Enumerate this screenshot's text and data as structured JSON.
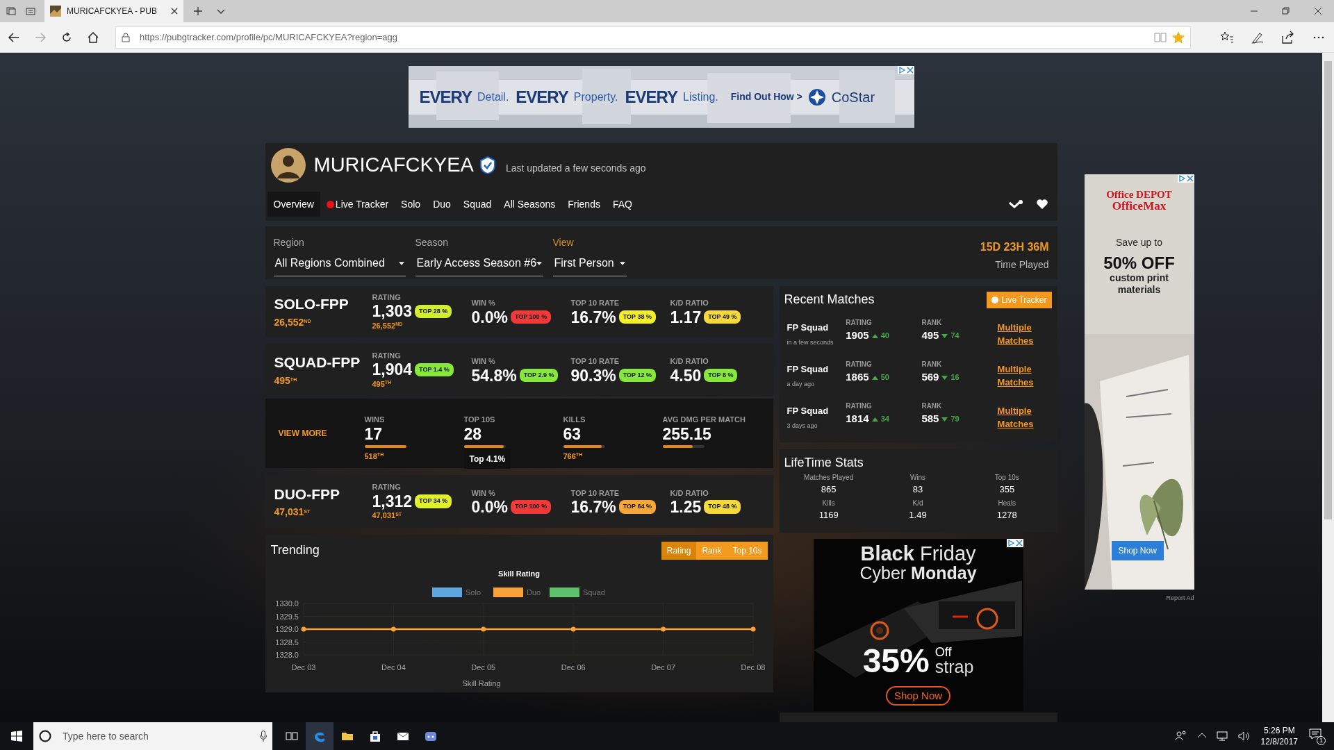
{
  "browser": {
    "tab_title": "MURICAFCKYEA - PUB",
    "url": "https://pubgtracker.com/profile/pc/MURICAFCKYEA?region=agg",
    "favorite": true
  },
  "top_ad": {
    "words": [
      {
        "text": "EVERY",
        "kind": "strong"
      },
      {
        "text": "Detail.",
        "kind": "light"
      },
      {
        "text": "EVERY",
        "kind": "strong"
      },
      {
        "text": "Property.",
        "kind": "light"
      },
      {
        "text": "EVERY",
        "kind": "strong"
      },
      {
        "text": "Listing.",
        "kind": "light"
      },
      {
        "text": "Find Out How >",
        "kind": "cta"
      },
      {
        "text": "CoStar",
        "kind": "logo"
      }
    ]
  },
  "profile": {
    "name": "MURICAFCKYEA",
    "verified": true,
    "updated": "Last updated a few seconds ago"
  },
  "nav": [
    {
      "label": "Overview",
      "selected": true,
      "live": false
    },
    {
      "label": "Live Tracker",
      "selected": false,
      "live": true
    },
    {
      "label": "Solo",
      "selected": false,
      "live": false
    },
    {
      "label": "Duo",
      "selected": false,
      "live": false
    },
    {
      "label": "Squad",
      "selected": false,
      "live": false
    },
    {
      "label": "All Seasons",
      "selected": false,
      "live": false
    },
    {
      "label": "Friends",
      "selected": false,
      "live": false
    },
    {
      "label": "FAQ",
      "selected": false,
      "live": false
    }
  ],
  "filters": [
    {
      "label": "Region",
      "value": "All Regions Combined",
      "accent": false
    },
    {
      "label": "Season",
      "value": "Early Access Season #6",
      "accent": false
    },
    {
      "label": "View",
      "value": "First Person",
      "accent": true
    }
  ],
  "time_played": {
    "value": "15D 23H 36M",
    "label": "Time Played"
  },
  "modes": [
    {
      "name": "SOLO-FPP",
      "rank": "26,552$^{ND}$",
      "stats": [
        {
          "label": "RATING",
          "value": "1,303",
          "badge": "TOP 28 %",
          "color": "#d2ee2c",
          "sub": "26,552$^{ND}$"
        },
        {
          "label": "WIN %",
          "value": "0.0%",
          "badge": "TOP 100 %",
          "color": "#f03a3a"
        },
        {
          "label": "TOP 10 RATE",
          "value": "16.7%",
          "badge": "TOP 38 %",
          "color": "#f2ee2c"
        },
        {
          "label": "K/D RATIO",
          "value": "1.17",
          "badge": "TOP 49 %",
          "color": "#f5d93c"
        }
      ]
    },
    {
      "name": "SQUAD-FPP",
      "rank": "495$^{TH}$",
      "stats": [
        {
          "label": "RATING",
          "value": "1,904",
          "badge": "TOP 1.4 %",
          "color": "#86e83a",
          "sub": "495$^{TH}$"
        },
        {
          "label": "WIN %",
          "value": "54.8%",
          "badge": "TOP 2.9 %",
          "color": "#86e83a"
        },
        {
          "label": "TOP 10 RATE",
          "value": "90.3%",
          "badge": "TOP 12 %",
          "color": "#86e83a"
        },
        {
          "label": "K/D RATIO",
          "value": "4.50",
          "badge": "TOP 8 %",
          "color": "#86e83a"
        }
      ],
      "details": {
        "link": "VIEW MORE",
        "stats": [
          {
            "label": "WINS",
            "value": "17",
            "level": 1.0,
            "rank": "518$^{TH}$"
          },
          {
            "label": "TOP 10S",
            "value": "28",
            "level": 0.95,
            "tooltip": "Top 4.1%"
          },
          {
            "label": "KILLS",
            "value": "63",
            "level": 0.92,
            "rank": "766$^{TH}$"
          },
          {
            "label": "AVG DMG PER MATCH",
            "value": "255.15",
            "level": 0.73
          }
        ]
      }
    },
    {
      "name": "DUO-FPP",
      "rank": "47,031$^{ST}$",
      "stats": [
        {
          "label": "RATING",
          "value": "1,312",
          "badge": "TOP 34 %",
          "color": "#e0f02c",
          "sub": "47,031$^{ST}$"
        },
        {
          "label": "WIN %",
          "value": "0.0%",
          "badge": "TOP 100 %",
          "color": "#f03a3a"
        },
        {
          "label": "TOP 10 RATE",
          "value": "16.7%",
          "badge": "TOP 64 %",
          "color": "#f7a73a"
        },
        {
          "label": "K/D RATIO",
          "value": "1.25",
          "badge": "TOP 48 %",
          "color": "#f5d93c"
        }
      ]
    }
  ],
  "trending": {
    "title": "Trending",
    "buttons": [
      {
        "label": "Rating",
        "selected": true
      },
      {
        "label": "Rank",
        "selected": false
      },
      {
        "label": "Top 10s",
        "selected": false
      }
    ],
    "chart_data": {
      "type": "line",
      "title": "Skill Rating",
      "xlabel": "Skill Rating",
      "categories": [
        "Dec 03",
        "Dec 04",
        "Dec 05",
        "Dec 06",
        "Dec 07",
        "Dec 08"
      ],
      "series": [
        {
          "name": "Solo",
          "color": "#5ea7e0",
          "values": [
            null,
            null,
            null,
            null,
            null,
            null
          ]
        },
        {
          "name": "Duo",
          "color": "#f9a23a",
          "marker": "circle",
          "values": [
            1329,
            1329,
            1329,
            1329,
            1329,
            1329
          ]
        },
        {
          "name": "Squad",
          "color": "#5cc06c",
          "values": [
            null,
            null,
            null,
            null,
            null,
            null
          ]
        }
      ],
      "ylim": [
        1328,
        1330
      ],
      "grid": true,
      "yticks": [
        {
          "value": 1330,
          "label": "1330.0"
        },
        {
          "value": 1329.5,
          "label": "1329.5"
        },
        {
          "value": 1329,
          "label": "1329.0"
        },
        {
          "value": 1328.5,
          "label": "1328.5"
        },
        {
          "value": 1328,
          "label": "1328.0"
        }
      ]
    }
  },
  "recent": {
    "title": "Recent Matches",
    "button": "Live Tracker",
    "matches": [
      {
        "mode": "FP Squad",
        "time": "in a few seconds",
        "rating_label": "RATING",
        "rating": "1905",
        "rating_change": "40",
        "rating_up": true,
        "rank_label": "RANK",
        "rank": "495",
        "rank_change": "74",
        "rank_up": false,
        "link": "Multiple Matches"
      },
      {
        "mode": "FP Squad",
        "time": "a day ago",
        "rating_label": "RATING",
        "rating": "1865",
        "rating_change": "50",
        "rating_up": true,
        "rank_label": "RANK",
        "rank": "569",
        "rank_change": "16",
        "rank_up": false,
        "link": "Multiple Matches"
      },
      {
        "mode": "FP Squad",
        "time": "3 days ago",
        "rating_label": "RATING",
        "rating": "1814",
        "rating_change": "34",
        "rating_up": true,
        "rank_label": "RANK",
        "rank": "585",
        "rank_change": "79",
        "rank_up": false,
        "link": "Multiple Matches"
      }
    ]
  },
  "lifetime": {
    "title": "LifeTime Stats",
    "stats": [
      {
        "label": "Matches Played",
        "value": "865"
      },
      {
        "label": "Wins",
        "value": "83"
      },
      {
        "label": "Top 10s",
        "value": "355"
      },
      {
        "label": "Kills",
        "value": "1169"
      },
      {
        "label": "K/d",
        "value": "1.49"
      },
      {
        "label": "Heals",
        "value": "1278"
      }
    ]
  },
  "promo_ad": {
    "headline": "**Black** Friday",
    "subline": "Cyber **Monday**",
    "discount": "35%",
    "off": "Off",
    "brand": "strap",
    "button": "Shop Now"
  },
  "side_ad": {
    "brand": "Office DEPOT",
    "brand2": "OfficeMax",
    "lead": "Save up to",
    "offer": "50% OFF",
    "detail": "custom print materials",
    "button": "Shop Now",
    "report": "Report Ad"
  },
  "taskbar": {
    "search_placeholder": "Type here to search",
    "apps": [
      {
        "kind": "taskview",
        "active": false
      },
      {
        "kind": "edge",
        "active": true
      },
      {
        "kind": "folder",
        "active": false
      },
      {
        "kind": "store",
        "active": false
      },
      {
        "kind": "mail",
        "active": false
      },
      {
        "kind": "discord",
        "active": false
      }
    ],
    "time": "5:26 PM",
    "date": "12/8/2017",
    "notifications": "1"
  }
}
